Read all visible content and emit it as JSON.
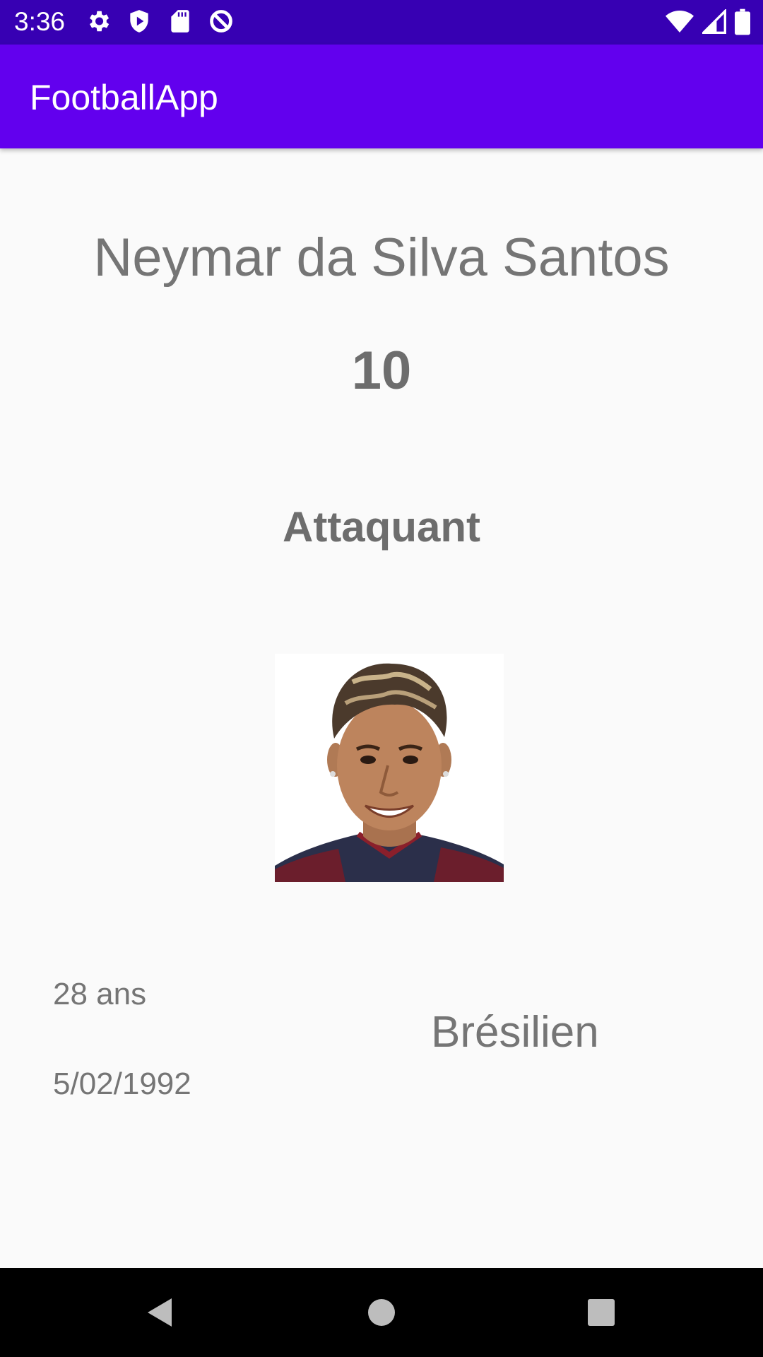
{
  "status_bar": {
    "time": "3:36",
    "left_icons": [
      "settings-icon",
      "play-protect-icon",
      "sd-card-icon",
      "data-saver-icon"
    ],
    "right_icons": [
      "wifi-icon",
      "cell-signal-icon",
      "battery-icon"
    ]
  },
  "app_bar": {
    "title": "FootballApp",
    "color": "#6200ee",
    "status_color": "#3700b3"
  },
  "player": {
    "name": "Neymar da Silva Santos",
    "number": "10",
    "position": "Attaquant",
    "photo_icon": "player-portrait",
    "age": "28 ans",
    "birthdate": "5/02/1992",
    "nationality": "Brésilien"
  },
  "nav_bar": {
    "buttons": [
      "back-icon",
      "home-icon",
      "recents-icon"
    ]
  }
}
